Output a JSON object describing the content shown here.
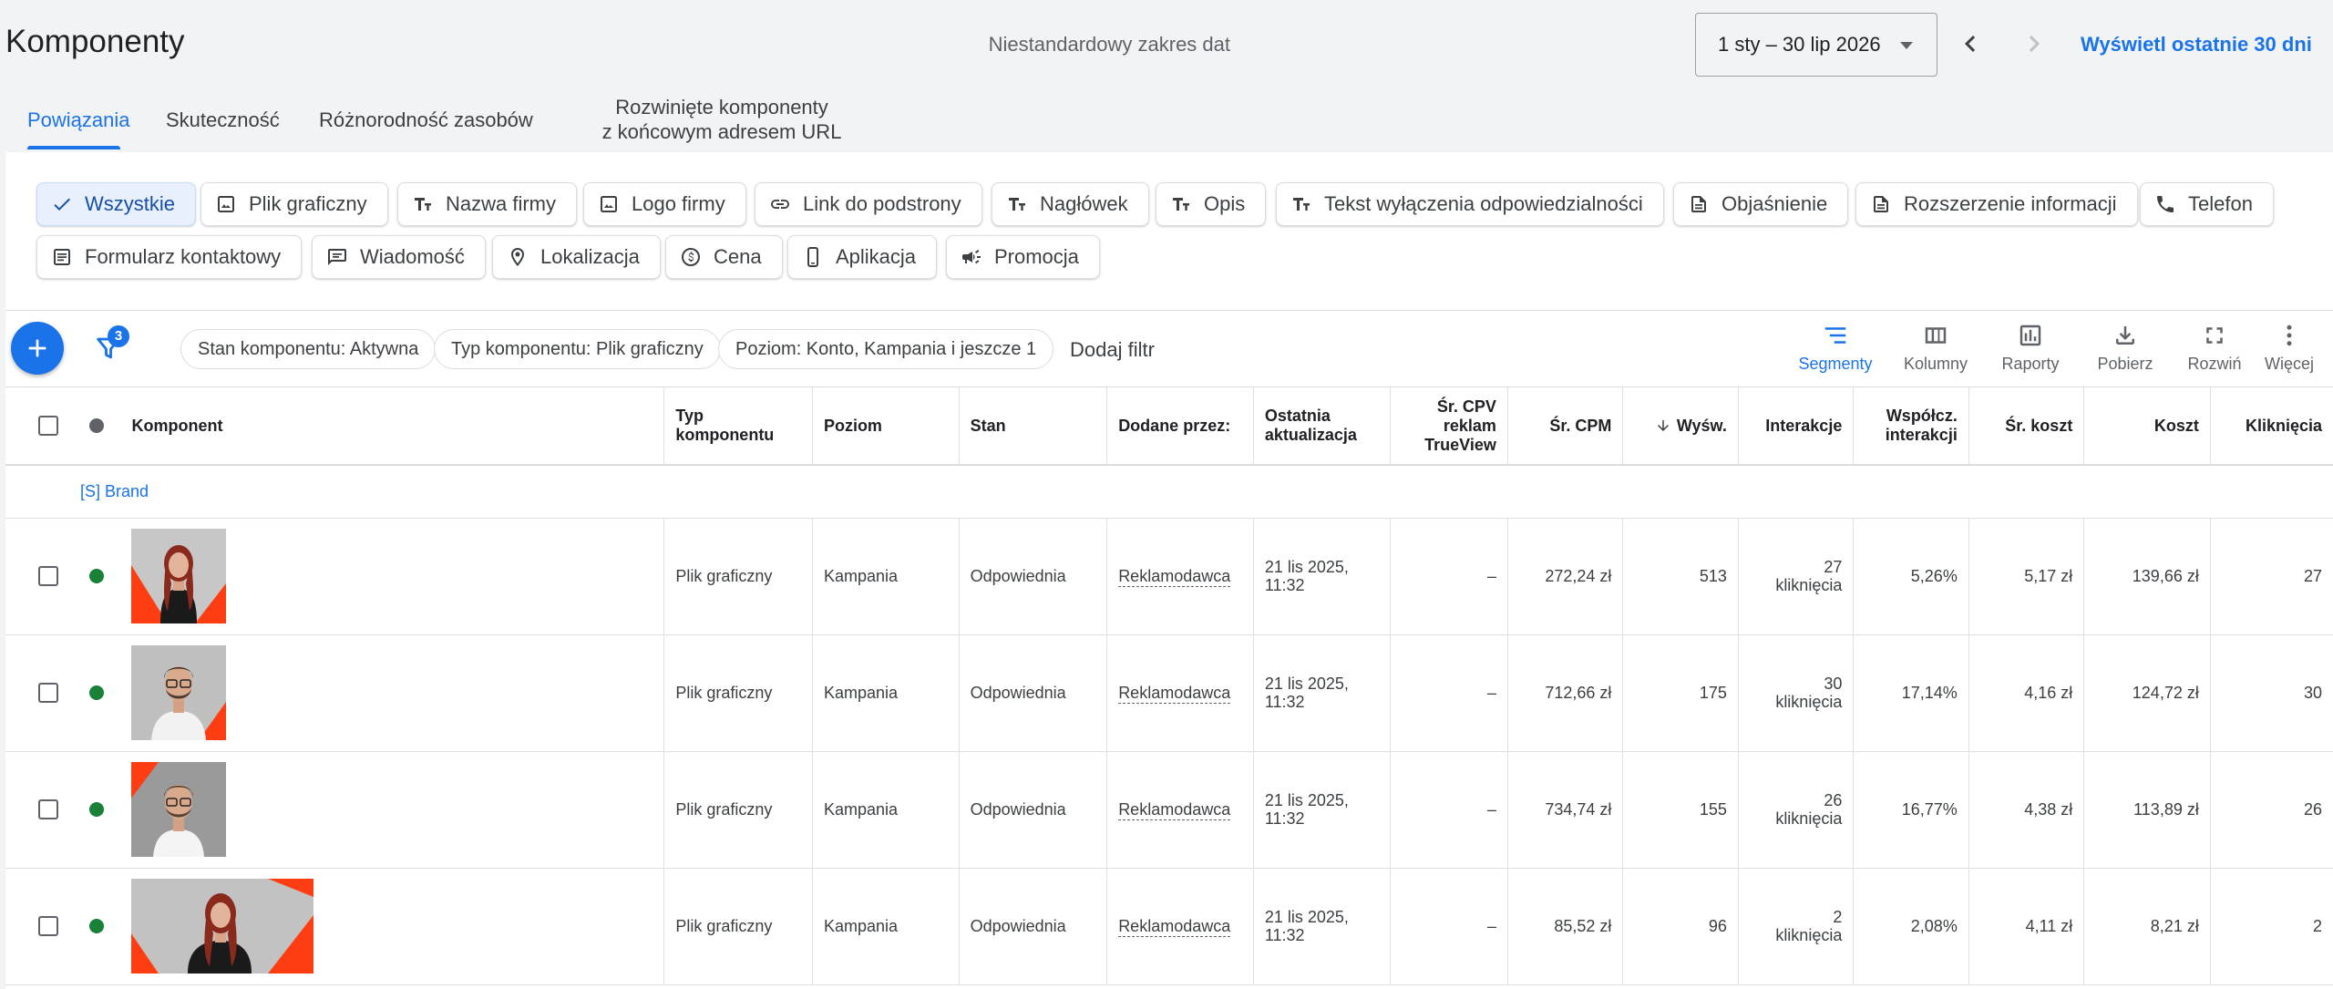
{
  "header": {
    "title": "Komponenty",
    "date_range_label": "Niestandardowy zakres dat",
    "date_range_value": "1 sty – 30 lip 2026",
    "show_last_30": "Wyświetl ostatnie 30 dni"
  },
  "tabs": [
    {
      "label": "Powiązania",
      "active": true
    },
    {
      "label": "Skuteczność"
    },
    {
      "label": "Różnorodność zasobów"
    },
    {
      "label_line1": "Rozwinięte komponenty",
      "label_line2": "z końcowym adresem URL"
    }
  ],
  "chips": [
    {
      "label": "Wszystkie",
      "icon": "check-icon",
      "selected": true
    },
    {
      "label": "Plik graficzny",
      "icon": "image-icon"
    },
    {
      "label": "Nazwa firmy",
      "icon": "text-icon"
    },
    {
      "label": "Logo firmy",
      "icon": "image-icon"
    },
    {
      "label": "Link do podstrony",
      "icon": "link-icon"
    },
    {
      "label": "Nagłówek",
      "icon": "text-icon"
    },
    {
      "label": "Opis",
      "icon": "text-icon"
    },
    {
      "label": "Tekst wyłączenia odpowiedzialności",
      "icon": "text-icon"
    },
    {
      "label": "Objaśnienie",
      "icon": "document-icon"
    },
    {
      "label": "Rozszerzenie informacji",
      "icon": "document-icon"
    },
    {
      "label": "Telefon",
      "icon": "phone-icon"
    },
    {
      "label": "Formularz kontaktowy",
      "icon": "form-icon"
    },
    {
      "label": "Wiadomość",
      "icon": "message-icon"
    },
    {
      "label": "Lokalizacja",
      "icon": "location-icon"
    },
    {
      "label": "Cena",
      "icon": "price-icon"
    },
    {
      "label": "Aplikacja",
      "icon": "phone-app-icon"
    },
    {
      "label": "Promocja",
      "icon": "megaphone-icon"
    }
  ],
  "toolbar": {
    "filter_count": "3",
    "filters": [
      "Stan komponentu: Aktywna",
      "Typ komponentu: Plik graficzny",
      "Poziom: Konto, Kampania i jeszcze 1"
    ],
    "add_filter": "Dodaj filtr",
    "tools": [
      {
        "label": "Segmenty",
        "icon": "segments-icon",
        "active": true
      },
      {
        "label": "Kolumny",
        "icon": "columns-icon"
      },
      {
        "label": "Raporty",
        "icon": "reports-icon"
      },
      {
        "label": "Pobierz",
        "icon": "download-icon"
      },
      {
        "label": "Rozwiń",
        "icon": "fullscreen-icon"
      },
      {
        "label": "Więcej",
        "icon": "more-vert-icon"
      }
    ]
  },
  "table": {
    "columns": {
      "component": "Komponent",
      "type": "Typ komponentu",
      "level": "Poziom",
      "status": "Stan",
      "added_by": "Dodane przez:",
      "last_update_1": "Ostatnia",
      "last_update_2": "aktualizacja",
      "cpv_1": "Śr. CPV",
      "cpv_2": "reklam",
      "cpv_3": "TrueView",
      "cpm": "Śr. CPM",
      "impr": "Wyśw.",
      "interactions": "Interakcje",
      "int_rate_1": "Współcz.",
      "int_rate_2": "interakcji",
      "avg_cost": "Śr. koszt",
      "cost": "Koszt",
      "clicks": "Kliknięcia"
    },
    "group_label": "[S] Brand",
    "rows": [
      {
        "type": "Plik graficzny",
        "level": "Kampania",
        "status": "Odpowiednia",
        "added_by": "Reklamodawca",
        "date": "21 lis 2025,",
        "time": "11:32",
        "cpv": "–",
        "cpm": "272,24 zł",
        "impr": "513",
        "int_n": "27",
        "int_u": "kliknięcia",
        "rate": "5,26%",
        "avg": "5,17 zł",
        "cost": "139,66 zł",
        "clicks": "27"
      },
      {
        "type": "Plik graficzny",
        "level": "Kampania",
        "status": "Odpowiednia",
        "added_by": "Reklamodawca",
        "date": "21 lis 2025,",
        "time": "11:32",
        "cpv": "–",
        "cpm": "712,66 zł",
        "impr": "175",
        "int_n": "30",
        "int_u": "kliknięcia",
        "rate": "17,14%",
        "avg": "4,16 zł",
        "cost": "124,72 zł",
        "clicks": "30"
      },
      {
        "type": "Plik graficzny",
        "level": "Kampania",
        "status": "Odpowiednia",
        "added_by": "Reklamodawca",
        "date": "21 lis 2025,",
        "time": "11:32",
        "cpv": "–",
        "cpm": "734,74 zł",
        "impr": "155",
        "int_n": "26",
        "int_u": "kliknięcia",
        "rate": "16,77%",
        "avg": "4,38 zł",
        "cost": "113,89 zł",
        "clicks": "26"
      },
      {
        "type": "Plik graficzny",
        "level": "Kampania",
        "status": "Odpowiednia",
        "added_by": "Reklamodawca",
        "date": "21 lis 2025,",
        "time": "11:32",
        "cpv": "–",
        "cpm": "85,52 zł",
        "impr": "96",
        "int_n": "2",
        "int_u": "kliknięcia",
        "rate": "2,08%",
        "avg": "4,11 zł",
        "cost": "8,21 zł",
        "clicks": "2"
      }
    ]
  },
  "colors": {
    "accent": "#1a73e8",
    "active_status": "#188038",
    "brand_red": "#ff3d12"
  }
}
